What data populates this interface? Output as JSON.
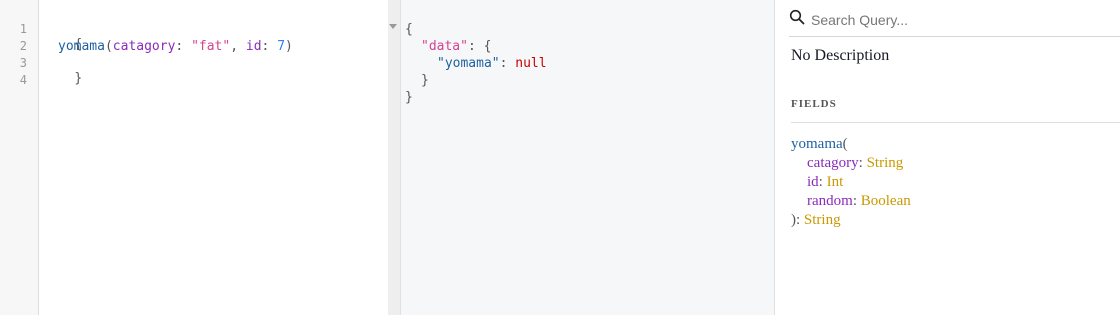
{
  "query_editor": {
    "line_numbers": [
      "1",
      "2",
      "3",
      "4"
    ],
    "line1_brace": "{",
    "line2": {
      "field": "yomama",
      "open": "(",
      "arg1": "catagory",
      "colon1": ": ",
      "str": "\"fat\"",
      "comma": ", ",
      "arg2": "id",
      "colon2": ": ",
      "num": "7",
      "close": ")"
    },
    "line3_brace": "}"
  },
  "result_viewer": {
    "open_brace": "{",
    "data_key": "\"data\"",
    "data_sep": ": {",
    "yomama_key": "\"yomama\"",
    "yomama_sep": ": ",
    "yomama_value": "null",
    "inner_close": "}",
    "outer_close": "}"
  },
  "docs": {
    "search_placeholder": "Search Query...",
    "description": "No Description",
    "fields_title": "FIELDS",
    "field": {
      "name": "yomama",
      "open": "(",
      "args": [
        {
          "name": "catagory",
          "type": "String"
        },
        {
          "name": "id",
          "type": "Int"
        },
        {
          "name": "random",
          "type": "Boolean"
        }
      ],
      "close": "): ",
      "return_type": "String"
    }
  }
}
